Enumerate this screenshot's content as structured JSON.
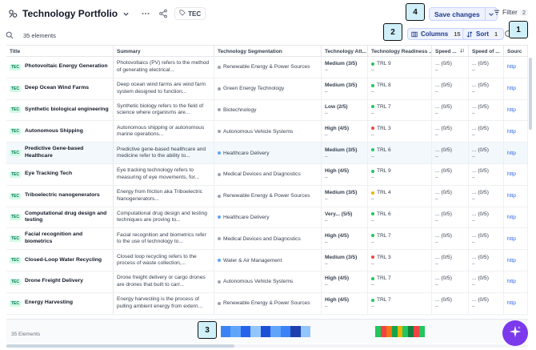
{
  "header": {
    "title": "Technology Portfolio",
    "tag_label": "TEC",
    "save_label": "Save changes",
    "filter_label": "Filter",
    "filter_count": "2"
  },
  "toolbar": {
    "elements_count": "35 elements",
    "columns_label": "Columns",
    "columns_count": "15",
    "sort_label": "Sort",
    "sort_count": "1"
  },
  "callouts": [
    "1",
    "2",
    "3",
    "4"
  ],
  "columns": [
    "Title",
    "Summary",
    "Technology Segmentation",
    "Technology Att...",
    "Technology Readiness ...",
    "Speed ...",
    "Speed of ...",
    "Sourc"
  ],
  "rows": [
    {
      "badge": "TEC",
      "title": "Photovoltaic Energy Generation",
      "summary": "Photovoltaics (PV) refers to the method of generating electrical...",
      "segment": "Renewable Energy & Power Sources",
      "segment_color": "#9ca3af",
      "attractiveness": "Medium (3/5)",
      "att_sub": "–",
      "trl": "TRL 9",
      "trl_color": "#22c55e",
      "trl_sub": "–",
      "sp1": "(0/5)",
      "sp1_a": "...",
      "sp1_b": "–",
      "sp2": "(0/5)",
      "sp2_a": "...",
      "sp2_b": "–",
      "src": "http"
    },
    {
      "badge": "TEC",
      "title": "Deep Ocean Wind Farms",
      "summary": "Deep ocean wind farms are wind farm system designed to function...",
      "segment": "Green Energy Technology",
      "segment_color": "#9ca3af",
      "attractiveness": "Medium (3/5)",
      "att_sub": "–",
      "trl": "TRL 8",
      "trl_color": "#22c55e",
      "trl_sub": "–",
      "sp1": "(0/5)",
      "sp1_a": "...",
      "sp1_b": "–",
      "sp2": "(0/5)",
      "sp2_a": "...",
      "sp2_b": "–",
      "src": "http"
    },
    {
      "badge": "TEC",
      "title": "Synthetic biological engineering",
      "summary": "Synthetic biology refers to the field of science where organisms are...",
      "segment": "Biotechnology",
      "segment_color": "#9ca3af",
      "attractiveness": "Low (2/5)",
      "att_sub": "–",
      "trl": "TRL 7",
      "trl_color": "#22c55e",
      "trl_sub": "–",
      "sp1": "(0/5)",
      "sp1_a": "...",
      "sp1_b": "–",
      "sp2": "(0/5)",
      "sp2_a": "...",
      "sp2_b": "–",
      "src": "http"
    },
    {
      "badge": "TEC",
      "title": "Autonomous Shipping",
      "summary": "Autonomous shipping or autonomous marine operations...",
      "segment": "Autonomous Vehicle Systems",
      "segment_color": "#9ca3af",
      "attractiveness": "High (4/5)",
      "att_sub": "–",
      "trl": "TRL 3",
      "trl_color": "#ef4444",
      "trl_sub": "–",
      "sp1": "(0/5)",
      "sp1_a": "...",
      "sp1_b": "–",
      "sp2": "(0/5)",
      "sp2_a": "...",
      "sp2_b": "–",
      "src": "http"
    },
    {
      "badge": "TEC",
      "title": "Predictive Gene-based Healthcare",
      "summary": "Predictive gene-based healthcare and medicine refer to the ability to...",
      "segment": "Healthcare Delivery",
      "segment_color": "#60a5fa",
      "attractiveness": "Medium (3/5)",
      "att_sub": "–",
      "trl": "TRL 6",
      "trl_color": "#22c55e",
      "trl_sub": "–",
      "sp1": "(0/5)",
      "sp1_a": "...",
      "sp1_b": "–",
      "sp2": "(0/5)",
      "sp2_a": "...",
      "sp2_b": "–",
      "src": "http"
    },
    {
      "badge": "TEC",
      "title": "Eye Tracking Tech",
      "summary": "Eye tracking technology refers to measuring of eye movements, for...",
      "segment": "Medical Devices and Diagnostics",
      "segment_color": "#9ca3af",
      "attractiveness": "High (4/5)",
      "att_sub": "–",
      "trl": "TRL 9",
      "trl_color": "#22c55e",
      "trl_sub": "–",
      "sp1": "(0/5)",
      "sp1_a": "...",
      "sp1_b": "–",
      "sp2": "(0/5)",
      "sp2_a": "...",
      "sp2_b": "–",
      "src": "http"
    },
    {
      "badge": "TEC",
      "title": "Triboelectric nanogenerators",
      "summary": "Energy from friction aka Triboelectric Nanogenerators...",
      "segment": "Renewable Energy & Power Sources",
      "segment_color": "#9ca3af",
      "attractiveness": "Medium (3/5)",
      "att_sub": "–",
      "trl": "TRL 4",
      "trl_color": "#eab308",
      "trl_sub": "–",
      "sp1": "(0/5)",
      "sp1_a": "...",
      "sp1_b": "–",
      "sp2": "(0/5)",
      "sp2_a": "...",
      "sp2_b": "–",
      "src": "http"
    },
    {
      "badge": "TEC",
      "title": "Computational drug design and testing",
      "summary": "Computational drug design and testing techniques are proving to...",
      "segment": "Healthcare Delivery",
      "segment_color": "#60a5fa",
      "attractiveness": "Very...    (5/5)",
      "att_sub": "–",
      "trl": "TRL 6",
      "trl_color": "#22c55e",
      "trl_sub": "–",
      "sp1": "(0/5)",
      "sp1_a": "...",
      "sp1_b": "–",
      "sp2": "(0/5)",
      "sp2_a": "...",
      "sp2_b": "–",
      "src": "http"
    },
    {
      "badge": "TEC",
      "title": "Facial recognition and biometrics",
      "summary": "Facial recognition and biometrics refer to the use of technology to...",
      "segment": "Medical Devices and Diagnostics",
      "segment_color": "#9ca3af",
      "attractiveness": "High (4/5)",
      "att_sub": "–",
      "trl": "TRL 7",
      "trl_color": "#22c55e",
      "trl_sub": "–",
      "sp1": "(0/5)",
      "sp1_a": "...",
      "sp1_b": "–",
      "sp2": "(0/5)",
      "sp2_a": "...",
      "sp2_b": "–",
      "src": "http"
    },
    {
      "badge": "TEC",
      "title": "Closed-Loop Water Recycling",
      "summary": "Closed loop recycling refers to the process of waste collection,...",
      "segment": "Water & Air Management",
      "segment_color": "#60a5fa",
      "attractiveness": "Medium (3/5)",
      "att_sub": "–",
      "trl": "TRL 3",
      "trl_color": "#ef4444",
      "trl_sub": "–",
      "sp1": "(0/5)",
      "sp1_a": "...",
      "sp1_b": "–",
      "sp2": "(0/5)",
      "sp2_a": "...",
      "sp2_b": "–",
      "src": "http"
    },
    {
      "badge": "TEC",
      "title": "Drone Freight Delivery",
      "summary": "Drone freight delivery or cargo drones are drones that built to carr...",
      "segment": "Autonomous Vehicle Systems",
      "segment_color": "#9ca3af",
      "attractiveness": "High (4/5)",
      "att_sub": "–",
      "trl": "TRL 7",
      "trl_color": "#22c55e",
      "trl_sub": "–",
      "sp1": "(0/5)",
      "sp1_a": "...",
      "sp1_b": "–",
      "sp2": "(0/5)",
      "sp2_a": "...",
      "sp2_b": "–",
      "src": "http"
    },
    {
      "badge": "TEC",
      "title": "Energy Harvesting",
      "summary": "Energy harvesting is the process of pulling ambient energy from extern...",
      "segment": "Renewable Energy & Power Sources",
      "segment_color": "#9ca3af",
      "attractiveness": "High (4/5)",
      "att_sub": "–",
      "trl": "TRL 7",
      "trl_color": "#22c55e",
      "trl_sub": "–",
      "sp1": "(0/5)",
      "sp1_a": "...",
      "sp1_b": "–",
      "sp2": "(0/5)",
      "sp2_a": "...",
      "sp2_b": "–",
      "src": "http"
    }
  ],
  "footer": {
    "count_label": "35 Elements",
    "segmentation_bar": [
      "#3b82f6",
      "#60a5fa",
      "#2563eb",
      "#93c5fd",
      "#1d4ed8",
      "#60a5fa",
      "#3b82f6",
      "#1e40af",
      "#93c5fd"
    ],
    "trl_bar": [
      "#22c55e",
      "#ef4444",
      "#f97316",
      "#16a34a",
      "#eab308",
      "#22c55e",
      "#15803d",
      "#ef4444",
      "#22c55e"
    ]
  }
}
